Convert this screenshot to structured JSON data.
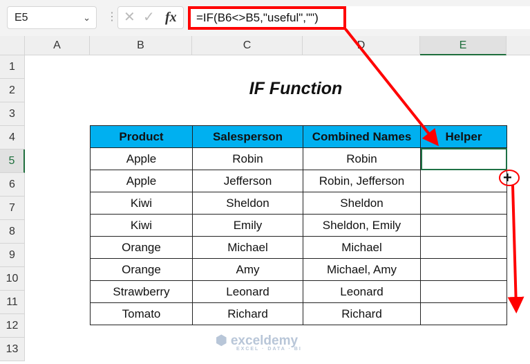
{
  "formula_bar": {
    "name_box": "E5",
    "cancel_icon": "✕",
    "enter_icon": "✓",
    "fx_label": "fx",
    "formula": "=IF(B6<>B5,\"useful\",\"\")"
  },
  "columns": [
    "A",
    "B",
    "C",
    "D",
    "E"
  ],
  "rows": [
    "1",
    "2",
    "3",
    "4",
    "5",
    "6",
    "7",
    "8",
    "9",
    "10",
    "11",
    "12",
    "13"
  ],
  "selected_cell": "E5",
  "title": "IF Function",
  "table": {
    "headers": [
      "Product",
      "Salesperson",
      "Combined Names",
      "Helper"
    ],
    "rows": [
      [
        "Apple",
        "Robin",
        "Robin",
        ""
      ],
      [
        "Apple",
        "Jefferson",
        "Robin, Jefferson",
        ""
      ],
      [
        "Kiwi",
        "Sheldon",
        "Sheldon",
        ""
      ],
      [
        "Kiwi",
        "Emily",
        "Sheldon, Emily",
        ""
      ],
      [
        "Orange",
        "Michael",
        "Michael",
        ""
      ],
      [
        "Orange",
        "Amy",
        "Michael, Amy",
        ""
      ],
      [
        "Strawberry",
        "Leonard",
        "Leonard",
        ""
      ],
      [
        "Tomato",
        "Richard",
        "Richard",
        ""
      ]
    ]
  },
  "header_fill": "#00B0F0",
  "annotation_color": "#FF0000",
  "watermark": {
    "name": "exceldemy",
    "tagline": "EXCEL · DATA · BI"
  }
}
